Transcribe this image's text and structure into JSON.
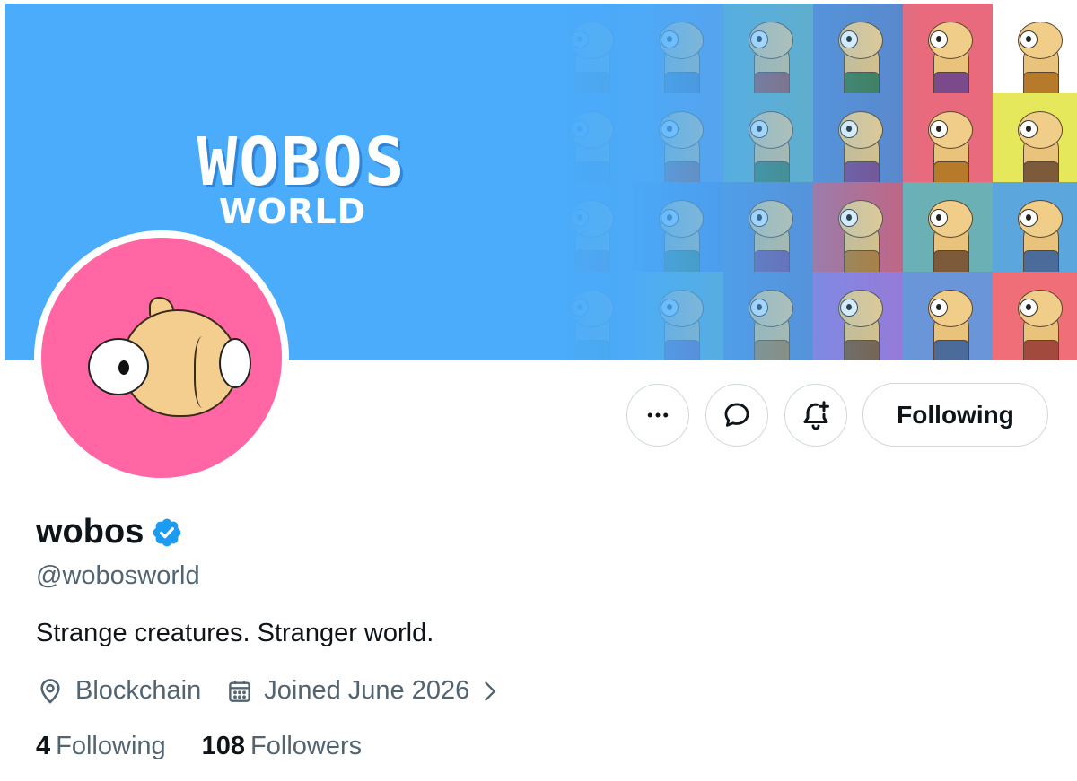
{
  "banner": {
    "logo_main": "WOBOS",
    "logo_sub": "WORLD",
    "background_color": "#4aacfb",
    "tile_colors": [
      [
        "#5b8fd6",
        "#6a95d8",
        "#6bb0b5",
        "#5b86c9",
        "#e86a7c",
        "#ffffff"
      ],
      [
        "#5b8fd6",
        "#6a95d8",
        "#6bb0b5",
        "#5b86c9",
        "#e86a7c",
        "#e4e85a"
      ],
      [
        "#5b8fd6",
        "#4f84d4",
        "#5b86c9",
        "#c7627e",
        "#6bb0b5",
        "#5aa6dd"
      ],
      [
        "#5b8fd6",
        "#6bb0b5",
        "#5b86c9",
        "#9b77d6",
        "#6a95d8",
        "#f06e78"
      ]
    ]
  },
  "avatar": {
    "background_color": "#ff66a3"
  },
  "actions": {
    "more_icon": "more-horizontal-icon",
    "message_icon": "message-bubble-icon",
    "notify_icon": "bell-plus-icon",
    "follow_label": "Following"
  },
  "profile": {
    "display_name": "wobos",
    "verified_icon": "verified-badge-icon",
    "verified_color": "#1d9bf0",
    "handle": "@wobosworld",
    "bio": "Strange creatures. Stranger world.",
    "location": "Blockchain",
    "location_icon": "location-pin-icon",
    "joined": "Joined June 2026",
    "joined_icon": "calendar-icon",
    "chevron_icon": "chevron-right-icon"
  },
  "stats": {
    "following_count": "4",
    "following_label": "Following",
    "followers_count": "108",
    "followers_label": "Followers"
  }
}
